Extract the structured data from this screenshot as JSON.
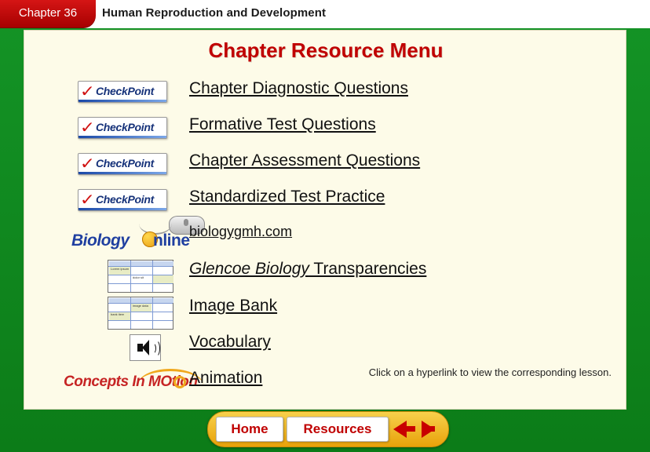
{
  "header": {
    "chapter_tab": "Chapter 36",
    "chapter_title": "Human Reproduction and Development"
  },
  "menu": {
    "title": "Chapter Resource Menu",
    "items": [
      {
        "label": "Chapter Diagnostic Questions",
        "icon": "checkpoint-logo",
        "icon_text": "CheckPoint"
      },
      {
        "label": "Formative Test Questions",
        "icon": "checkpoint-logo",
        "icon_text": "CheckPoint"
      },
      {
        "label": "Chapter Assessment Questions",
        "icon": "checkpoint-logo",
        "icon_text": "CheckPoint"
      },
      {
        "label": "Standardized Test Practice",
        "icon": "checkpoint-logo",
        "icon_text": "CheckPoint"
      },
      {
        "label": "biologygmh.com",
        "icon": "biology-online-logo",
        "icon_text": "Biology Online"
      },
      {
        "label_italic": "Glencoe Biology",
        "label_rest": " Transparencies",
        "icon": "transparency-grid-icon"
      },
      {
        "label": "Image Bank",
        "icon": "image-bank-grid-icon"
      },
      {
        "label": "Vocabulary",
        "icon": "speaker-audio-icon"
      },
      {
        "label": "Animation",
        "icon": "concepts-in-motion-logo",
        "icon_text": "Concepts In MOtion"
      }
    ],
    "footnote": "Click on a hyperlink to view the corresponding lesson."
  },
  "nav": {
    "home": "Home",
    "resources": "Resources",
    "back_arrow": "back-arrow",
    "forward_arrow": "forward-arrow"
  },
  "colors": {
    "frame_green": "#0f8c1e",
    "tab_red": "#c00000",
    "panel_cream": "#fdfbe8",
    "nav_gold": "#f0b816"
  }
}
